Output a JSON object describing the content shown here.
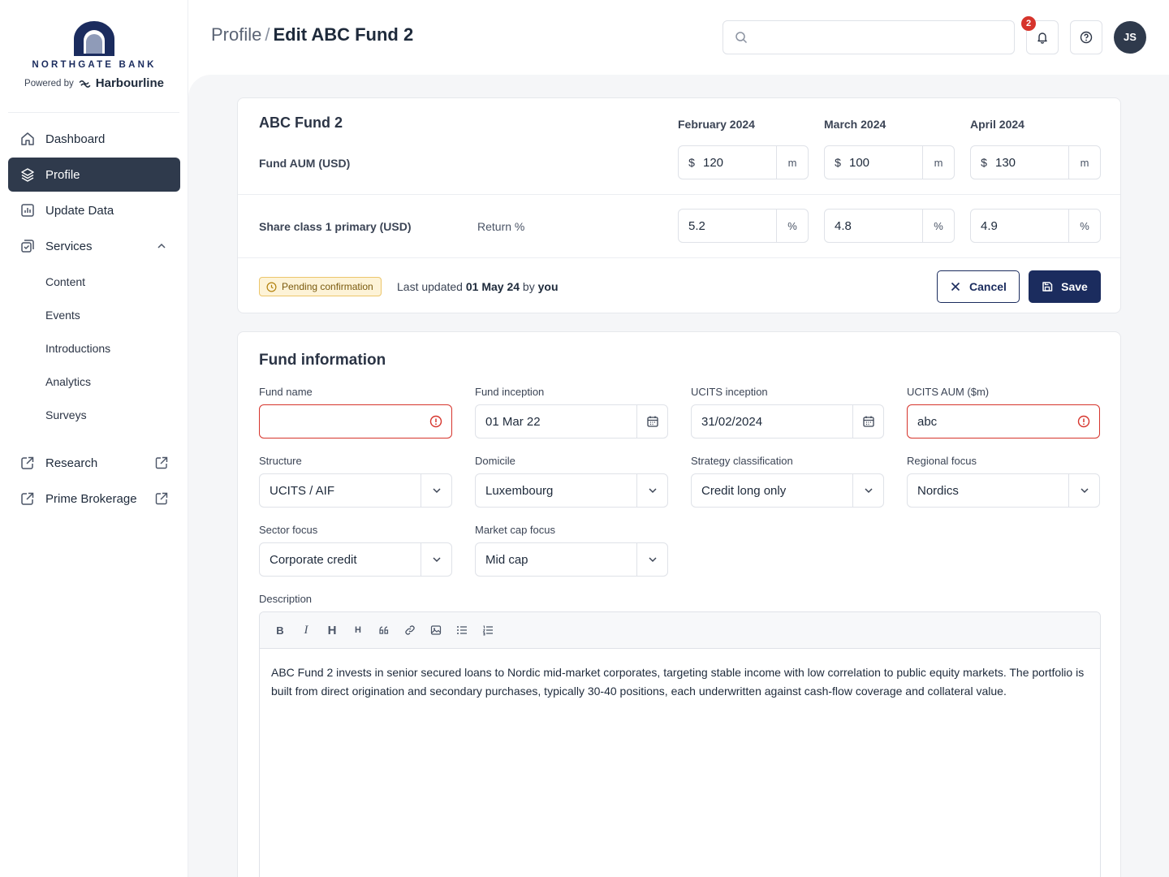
{
  "brand": {
    "name": "NORTHGATE BANK",
    "powered_label": "Powered by",
    "powered_name": "Harbourline",
    "primary_color": "#1b2c5e"
  },
  "nav": {
    "items": [
      {
        "label": "Dashboard",
        "icon": "home-icon"
      },
      {
        "label": "Profile",
        "icon": "layers-icon",
        "active": true
      },
      {
        "label": "Update Data",
        "icon": "chart-icon"
      },
      {
        "label": "Services",
        "icon": "services-icon",
        "expanded": true
      }
    ],
    "sub_items": [
      "Content",
      "Events",
      "Introductions",
      "Analytics",
      "Surveys"
    ],
    "external": [
      {
        "label": "Research",
        "icon": "external-link-icon"
      },
      {
        "label": "Prime Brokerage",
        "icon": "external-link-icon"
      }
    ]
  },
  "header": {
    "crumb_parent": "Profile",
    "crumb_sep": "/",
    "crumb_current": "Edit ABC Fund 2",
    "search_placeholder": "",
    "notification_count": "2",
    "avatar_initials": "JS"
  },
  "aum_card": {
    "title": "ABC Fund 2",
    "months": [
      "February 2024",
      "March 2024",
      "April 2024"
    ],
    "aum_label": "Fund AUM (USD)",
    "currency": "$",
    "unit": "m",
    "aum_values": [
      "120",
      "100",
      "130"
    ],
    "share_label": "Share class 1 primary (USD)",
    "return_label": "Return %",
    "pct": "%",
    "return_values": [
      "5.2",
      "4.8",
      "4.9"
    ],
    "status": "Pending confirmation",
    "last_updated_prefix": "Last updated",
    "last_updated_date": "01 May 24",
    "last_updated_by": "by",
    "last_updated_user": "you",
    "cancel_label": "Cancel",
    "save_label": "Save"
  },
  "fund_info": {
    "title": "Fund information",
    "fund_name_label": "Fund name",
    "fund_name_value": "",
    "inception_label": "Fund inception",
    "inception_value": "01 Mar 22",
    "ucits_inception_label": "UCITS inception",
    "ucits_inception_value": "31/02/2024",
    "ucits_aum_label": "UCITS AUM ($m)",
    "ucits_aum_value": "abc",
    "structure_label": "Structure",
    "structure_value": "UCITS / AIF",
    "domicile_label": "Domicile",
    "domicile_value": "Luxembourg",
    "strategy_label": "Strategy classification",
    "strategy_value": "Credit long only",
    "regional_label": "Regional focus",
    "regional_value": "Nordics",
    "sector_label": "Sector focus",
    "sector_value": "Corporate credit",
    "marketcap_label": "Market cap focus",
    "marketcap_value": "Mid cap",
    "description_label": "Description",
    "toolbar": [
      "bold-icon",
      "italic-icon",
      "heading-1-icon",
      "heading-2-icon",
      "quote-icon",
      "link-icon",
      "image-icon",
      "bullet-list-icon",
      "numbered-list-icon"
    ],
    "description": "ABC Fund 2 invests in senior secured loans to Nordic mid-market corporates, targeting stable income with low correlation to public equity markets. The portfolio is built from direct origination and secondary purchases, typically 30-40 positions, each underwritten against cash-flow coverage and collateral value."
  }
}
